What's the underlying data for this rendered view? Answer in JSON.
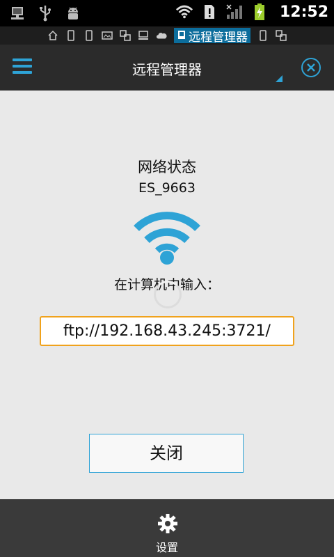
{
  "status_bar": {
    "time": "12:52",
    "icons": [
      "network-share-icon",
      "usb-icon",
      "android-debug-icon",
      "wifi-icon",
      "sim-alert-icon",
      "signal-icon",
      "battery-charging-icon"
    ]
  },
  "window_strip": {
    "icons": [
      "home-icon",
      "phone-icon",
      "phone-icon",
      "image-icon",
      "window-icon",
      "computer-icon",
      "cloud-icon"
    ],
    "active_label": "远程管理器"
  },
  "title_bar": {
    "title": "远程管理器"
  },
  "main": {
    "network_status_label": "网络状态",
    "ssid": "ES_9663",
    "input_hint": "在计算机中输入：",
    "ftp_address": "ftp://192.168.43.245:3721/",
    "close_button_label": "关闭"
  },
  "bottom_bar": {
    "settings_label": "设置"
  },
  "colors": {
    "accent": "#2ea3d6",
    "highlight_border": "#f0a21c",
    "title_bar_bg": "#2b2b2b",
    "bottom_bar_bg": "#3a3a3a",
    "page_bg": "#e9e9e9"
  }
}
